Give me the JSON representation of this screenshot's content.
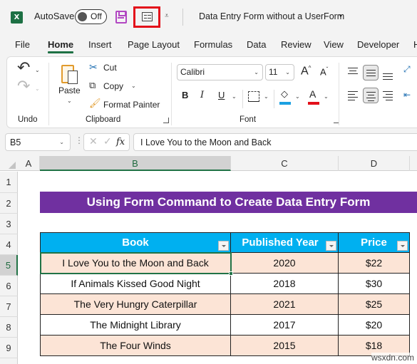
{
  "title_bar": {
    "app_icon": "excel-logo-icon",
    "app_letter": "X",
    "autosave_label": "AutoSave",
    "autosave_state": "Off",
    "save_icon": "save-icon",
    "form_icon": "form-icon",
    "more_icon": "customize-qat-icon",
    "document_title": "Data Entry Form without a UserForm",
    "title_caret": "▾"
  },
  "tabs": [
    {
      "label": "File",
      "active": false
    },
    {
      "label": "Home",
      "active": true
    },
    {
      "label": "Insert",
      "active": false
    },
    {
      "label": "Page Layout",
      "active": false
    },
    {
      "label": "Formulas",
      "active": false
    },
    {
      "label": "Data",
      "active": false
    },
    {
      "label": "Review",
      "active": false
    },
    {
      "label": "View",
      "active": false
    },
    {
      "label": "Developer",
      "active": false
    },
    {
      "label": "H",
      "active": false
    }
  ],
  "ribbon": {
    "undo_group": {
      "label": "Undo",
      "undo_icon": "↶",
      "redo_icon": "↷"
    },
    "clipboard_group": {
      "label": "Clipboard",
      "paste": "Paste",
      "cut": "Cut",
      "copy": "Copy",
      "format_painter": "Format Painter"
    },
    "font_group": {
      "label": "Font",
      "font_name": "Calibri",
      "font_size": "11",
      "grow": "A",
      "shrink": "A",
      "bold": "B",
      "italic": "I",
      "underline": "U",
      "font_color_letter": "A",
      "fill_color": "#1ba1e2",
      "font_color": "#e3101a"
    }
  },
  "formula_bar": {
    "name_box": "B5",
    "cancel_icon": "✕",
    "enter_icon": "✓",
    "fx_label": "fx",
    "formula": "I Love You to the Moon and Back"
  },
  "sheet": {
    "columns": [
      "A",
      "B",
      "C",
      "D"
    ],
    "selected_column": "B",
    "rows": [
      "1",
      "2",
      "3",
      "4",
      "5",
      "6",
      "7",
      "8",
      "9"
    ],
    "selected_row": "5",
    "banner": "Using Form Command to Create Data Entry Form",
    "table": {
      "headers": [
        "Book",
        "Published Year",
        "Price"
      ],
      "rows": [
        [
          "I Love You to the Moon and Back",
          "2020",
          "$22"
        ],
        [
          "If Animals Kissed Good Night",
          "2018",
          "$30"
        ],
        [
          "The Very Hungry Caterpillar",
          "2021",
          "$25"
        ],
        [
          "The Midnight Library",
          "2017",
          "$20"
        ],
        [
          "The Four Winds",
          "2015",
          "$18"
        ]
      ]
    },
    "colors": {
      "banner": "#7030a0",
      "header": "#00b0f0",
      "band": "#fce4d6",
      "selection": "#217346"
    }
  },
  "watermark": "wsxdn.com"
}
